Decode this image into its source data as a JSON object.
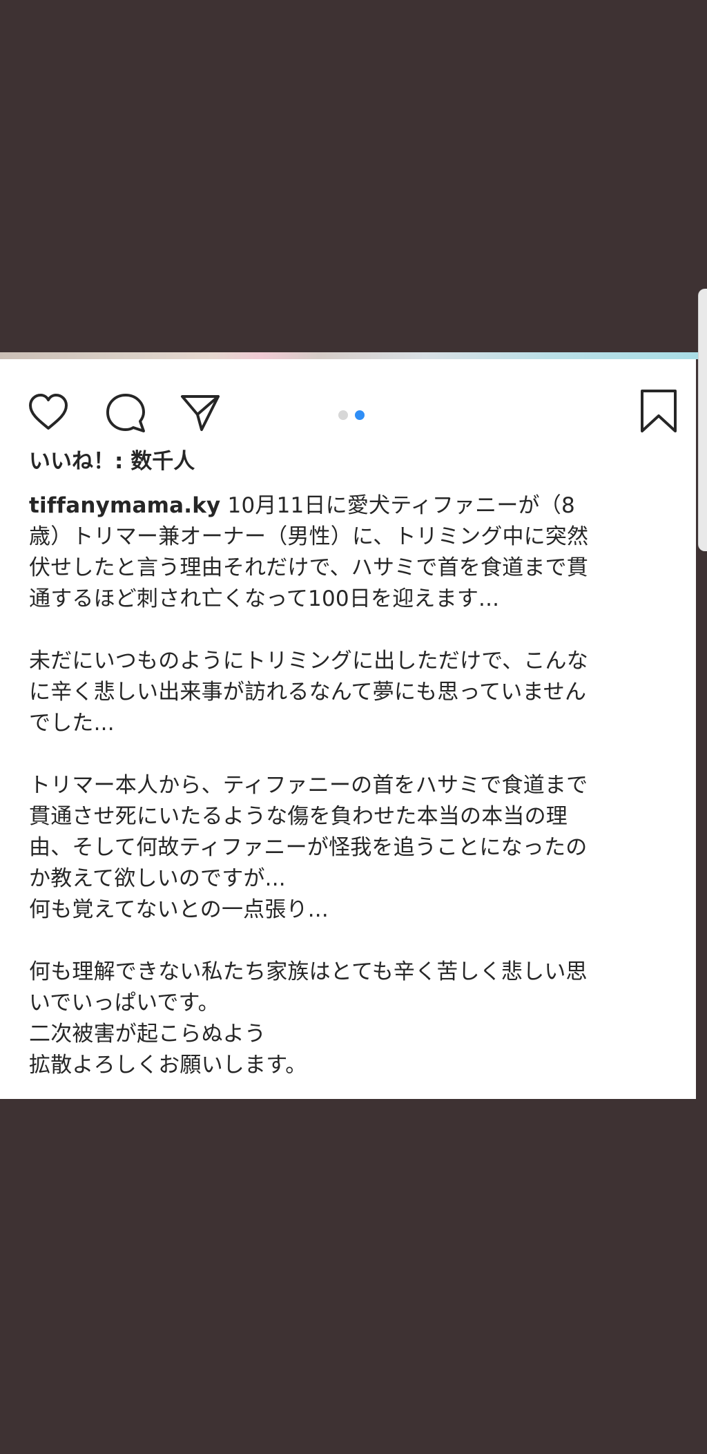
{
  "post": {
    "likes_text": "いいね！: 数千人",
    "carousel": {
      "count": 2,
      "active_index": 1
    },
    "caption": {
      "username": "tiffanymama.ky",
      "p1_line1_rest": " 10月11日に愛犬ティファニーが（8",
      "p1_line2": "歳）トリマー兼オーナー（男性）に、トリミング中に突然",
      "p1_line3": "伏せしたと言う理由それだけで、ハサミで首を食道まで貫",
      "p1_line4": "通するほど刺され亡くなって100日を迎えます...",
      "p2_line1": "未だにいつものようにトリミングに出しただけで、こんな",
      "p2_line2": "に辛く悲しい出来事が訪れるなんて夢にも思っていません",
      "p2_line3": "でした...",
      "p3_line1": "トリマー本人から、ティファニーの首をハサミで食道まで",
      "p3_line2": "貫通させ死にいたるような傷を負わせた本当の本当の理",
      "p3_line3": "由、そして何故ティファニーが怪我を追うことになったの",
      "p3_line4": "か教えて欲しいのですが...",
      "p3_line5": "何も覚えてないとの一点張り...",
      "p4_line1": "何も理解できない私たち家族はとても辛く苦しく悲しい思",
      "p4_line2": "いでいっぱいです。",
      "p4_line3": "二次被害が起こらぬよう",
      "p4_line4": "拡散よろしくお願いします。"
    }
  },
  "colors": {
    "background": "#3e3233",
    "panel": "#ffffff",
    "text": "#262626",
    "active_dot": "#2f8ef6",
    "inactive_dot": "#d7d7d7"
  },
  "icons": [
    "heart-icon",
    "comment-icon",
    "share-icon",
    "bookmark-icon"
  ]
}
